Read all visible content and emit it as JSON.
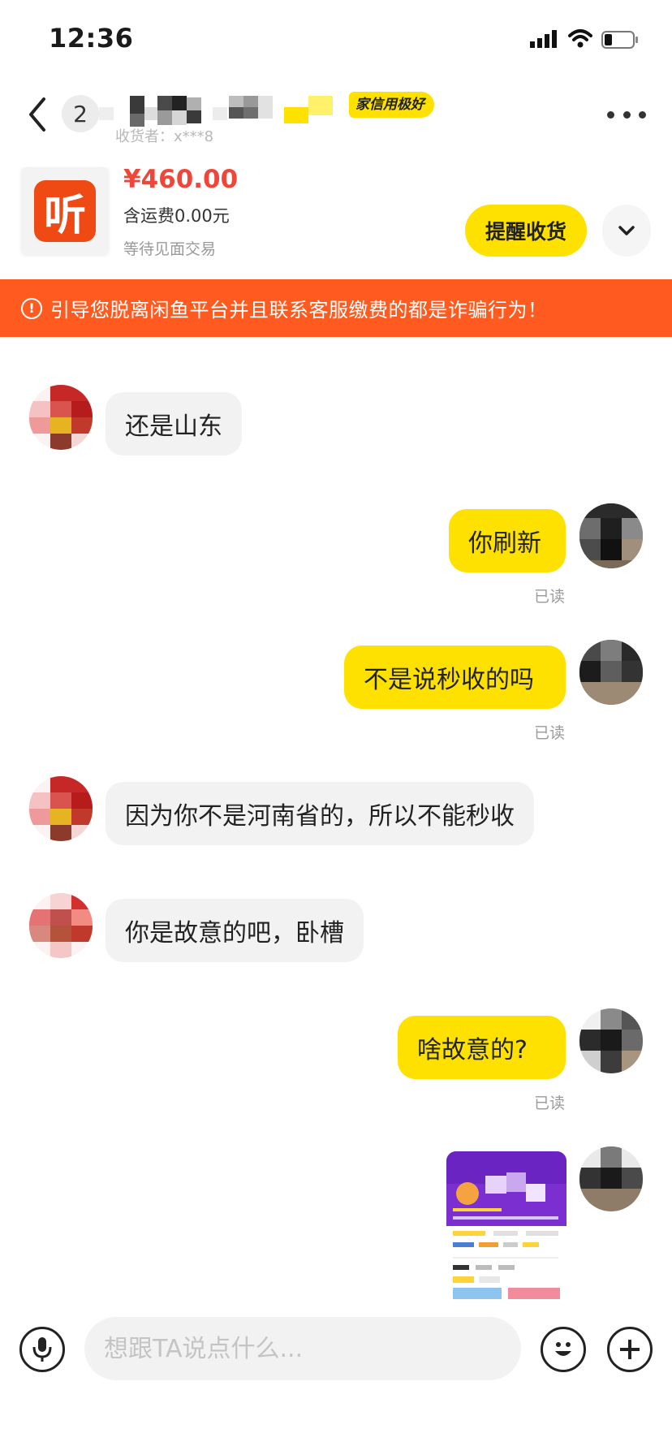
{
  "status_bar": {
    "time": "12:36"
  },
  "header": {
    "unread_count": "2",
    "credit_badge": "家信用极好",
    "seller_sub": "收货者：x***8"
  },
  "order": {
    "price": "¥460.00",
    "shipping": "含运费0.00元",
    "trade_status": "等待见面交易",
    "remind_button": "提醒收货",
    "thumb_glyph": "听"
  },
  "warning": {
    "icon": "!",
    "text": "引导您脱离闲鱼平台并且联系客服缴费的都是诈骗行为！"
  },
  "messages": [
    {
      "side": "in",
      "text": "还是山东"
    },
    {
      "side": "out",
      "text": "你刷新",
      "status": "已读"
    },
    {
      "side": "out",
      "text": "不是说秒收的吗",
      "status": "已读"
    },
    {
      "side": "in",
      "text": "因为你不是河南省的，所以不能秒收"
    },
    {
      "side": "in",
      "text": "你是故意的吧，卧槽"
    },
    {
      "side": "out",
      "text": "啥故意的?",
      "status": "已读"
    },
    {
      "side": "out",
      "type": "image",
      "image": "app-screenshot"
    }
  ],
  "input": {
    "placeholder": "想跟TA说点什么..."
  },
  "colors": {
    "accent": "#ffe100",
    "warning": "#ff5a1f",
    "price": "#f0463a"
  }
}
